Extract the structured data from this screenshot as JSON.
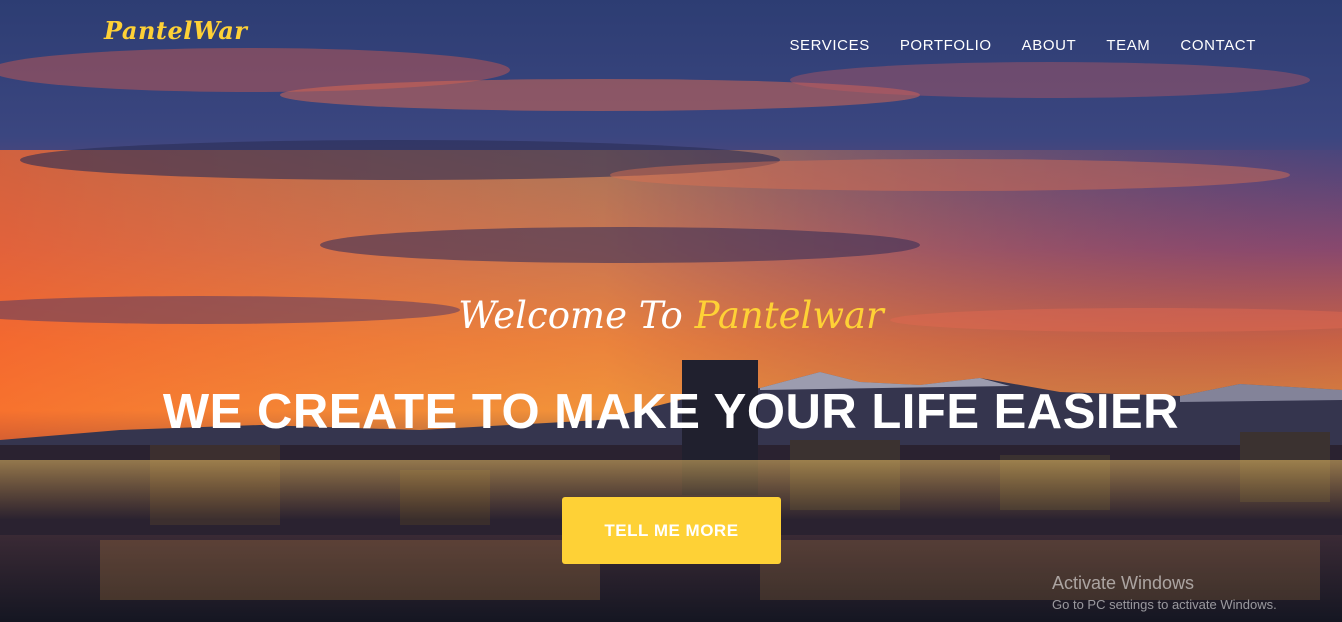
{
  "brand": {
    "name": "PantelWar"
  },
  "nav": {
    "items": [
      {
        "label": "SERVICES"
      },
      {
        "label": "PORTFOLIO"
      },
      {
        "label": "ABOUT"
      },
      {
        "label": "TEAM"
      },
      {
        "label": "CONTACT"
      }
    ]
  },
  "hero": {
    "welcome_prefix": "Welcome To",
    "welcome_accent": "Pantelwar",
    "headline": "WE CREATE TO MAKE YOUR LIFE EASIER",
    "cta_label": "TELL ME MORE"
  },
  "watermark": {
    "title": "Activate Windows",
    "subtitle": "Go to PC settings to activate Windows."
  },
  "colors": {
    "accent": "#fed136",
    "text": "#ffffff"
  }
}
